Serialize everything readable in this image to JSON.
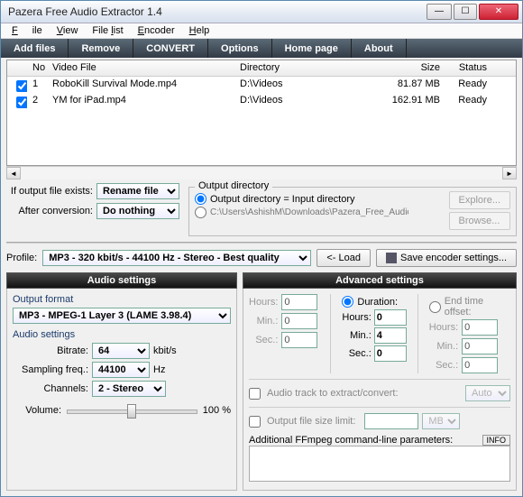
{
  "window": {
    "title": "Pazera Free Audio Extractor 1.4"
  },
  "menubar": {
    "file": "File",
    "view": "View",
    "filelist": "File list",
    "encoder": "Encoder",
    "help": "Help"
  },
  "toolbar": {
    "add": "Add files",
    "remove": "Remove",
    "convert": "CONVERT",
    "options": "Options",
    "home": "Home page",
    "about": "About"
  },
  "columns": {
    "no": "No",
    "video": "Video File",
    "dir": "Directory",
    "size": "Size",
    "status": "Status"
  },
  "rows": [
    {
      "no": "1",
      "video": "RoboKill Survival Mode.mp4",
      "dir": "D:\\Videos",
      "size": "81.87 MB",
      "status": "Ready"
    },
    {
      "no": "2",
      "video": "YM for iPad.mp4",
      "dir": "D:\\Videos",
      "size": "162.91 MB",
      "status": "Ready"
    }
  ],
  "outexists": {
    "label": "If output file exists:",
    "value": "Rename file"
  },
  "afterconv": {
    "label": "After conversion:",
    "value": "Do nothing"
  },
  "outdir": {
    "legend": "Output directory",
    "opt1": "Output directory = Input directory",
    "opt2_path": "C:\\Users\\AshishM\\Downloads\\Pazera_Free_Audio_Extractor",
    "explore": "Explore...",
    "browse": "Browse..."
  },
  "profile": {
    "label": "Profile:",
    "value": "MP3 - 320 kbit/s - 44100 Hz - Stereo - Best quality",
    "load": "<- Load",
    "save": "Save encoder settings..."
  },
  "audio": {
    "header": "Audio settings",
    "outfmt_label": "Output format",
    "outfmt_value": "MP3 - MPEG-1 Layer 3 (LAME 3.98.4)",
    "settings_label": "Audio settings",
    "bitrate_label": "Bitrate:",
    "bitrate_value": "64",
    "bitrate_unit": "kbit/s",
    "sfreq_label": "Sampling freq.:",
    "sfreq_value": "44100",
    "sfreq_unit": "Hz",
    "channels_label": "Channels:",
    "channels_value": "2 - Stereo",
    "volume_label": "Volume:",
    "volume_value": "100 %"
  },
  "adv": {
    "header": "Advanced settings",
    "hours": "Hours:",
    "min": "Min.:",
    "sec": "Sec.:",
    "start_h": "0",
    "start_m": "0",
    "start_s": "0",
    "duration_label": "Duration:",
    "endtime_label": "End time offset:",
    "dur_h": "0",
    "dur_m": "4",
    "dur_s": "0",
    "end_h": "0",
    "end_m": "0",
    "end_s": "0",
    "audiotrack_label": "Audio track to extract/convert:",
    "audiotrack_value": "Auto",
    "sizelimit_label": "Output file size limit:",
    "sizelimit_unit": "MB",
    "ffmpeg_label": "Additional FFmpeg command-line parameters:",
    "info": "INFO"
  }
}
